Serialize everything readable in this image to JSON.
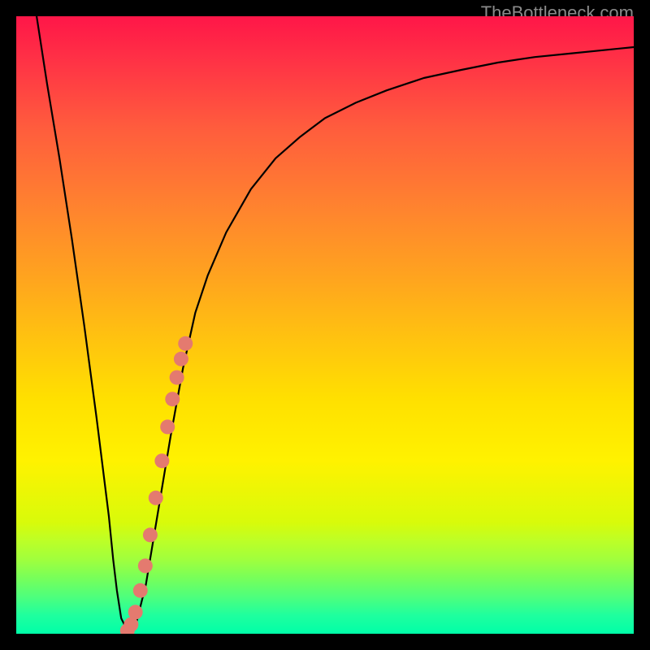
{
  "watermark": "TheBottleneck.com",
  "chart_data": {
    "type": "line",
    "title": "",
    "xlabel": "",
    "ylabel": "",
    "xlim": [
      0,
      100
    ],
    "ylim": [
      0,
      100
    ],
    "series": [
      {
        "name": "bottleneck-curve",
        "x": [
          3.3,
          5,
          7,
          9,
          11,
          13,
          14,
          15,
          15.7,
          16.3,
          17,
          18,
          19.5,
          21,
          23,
          25,
          27,
          29,
          31,
          34,
          38,
          42,
          46,
          50,
          55,
          60,
          66,
          72,
          78,
          84,
          90,
          95,
          100
        ],
        "values": [
          100,
          89,
          77,
          64,
          50,
          35,
          27,
          19,
          12,
          7,
          2.5,
          0.5,
          2,
          8,
          20,
          32,
          43,
          52,
          58,
          65,
          72,
          77,
          80.5,
          83.5,
          86,
          88,
          90,
          91.3,
          92.5,
          93.4,
          94,
          94.5,
          95
        ]
      },
      {
        "name": "highlight-points",
        "x": [
          18,
          18.6,
          19.3,
          20.1,
          20.9,
          21.7,
          22.6,
          23.6,
          24.5,
          25.3,
          26,
          26.7,
          27.4
        ],
        "values": [
          0.5,
          1.5,
          3.5,
          7,
          11,
          16,
          22,
          28,
          33.5,
          38,
          41.5,
          44.5,
          47
        ]
      }
    ],
    "colors": {
      "curve": "#000000",
      "points": "#e47a6f"
    }
  }
}
